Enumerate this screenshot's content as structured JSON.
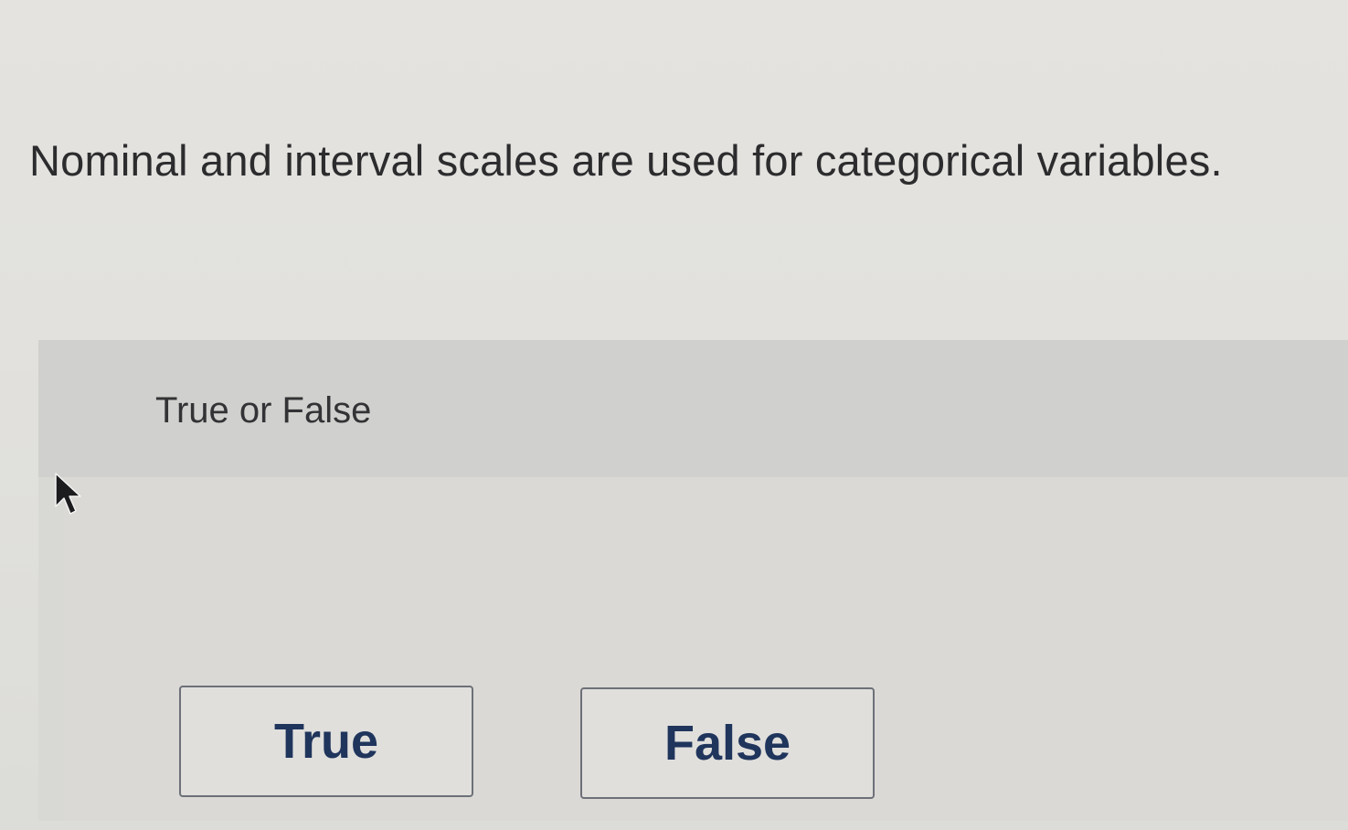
{
  "question": {
    "text": "Nominal and interval scales are used for categorical variables."
  },
  "answer_panel": {
    "prompt": "True or False",
    "choices": [
      {
        "label": "True"
      },
      {
        "label": "False"
      }
    ]
  },
  "colors": {
    "button_text": "#20355c",
    "button_border": "#6d7078",
    "question_text": "#2c2c2e"
  },
  "icons": {
    "cursor": "mouse-pointer-icon"
  }
}
